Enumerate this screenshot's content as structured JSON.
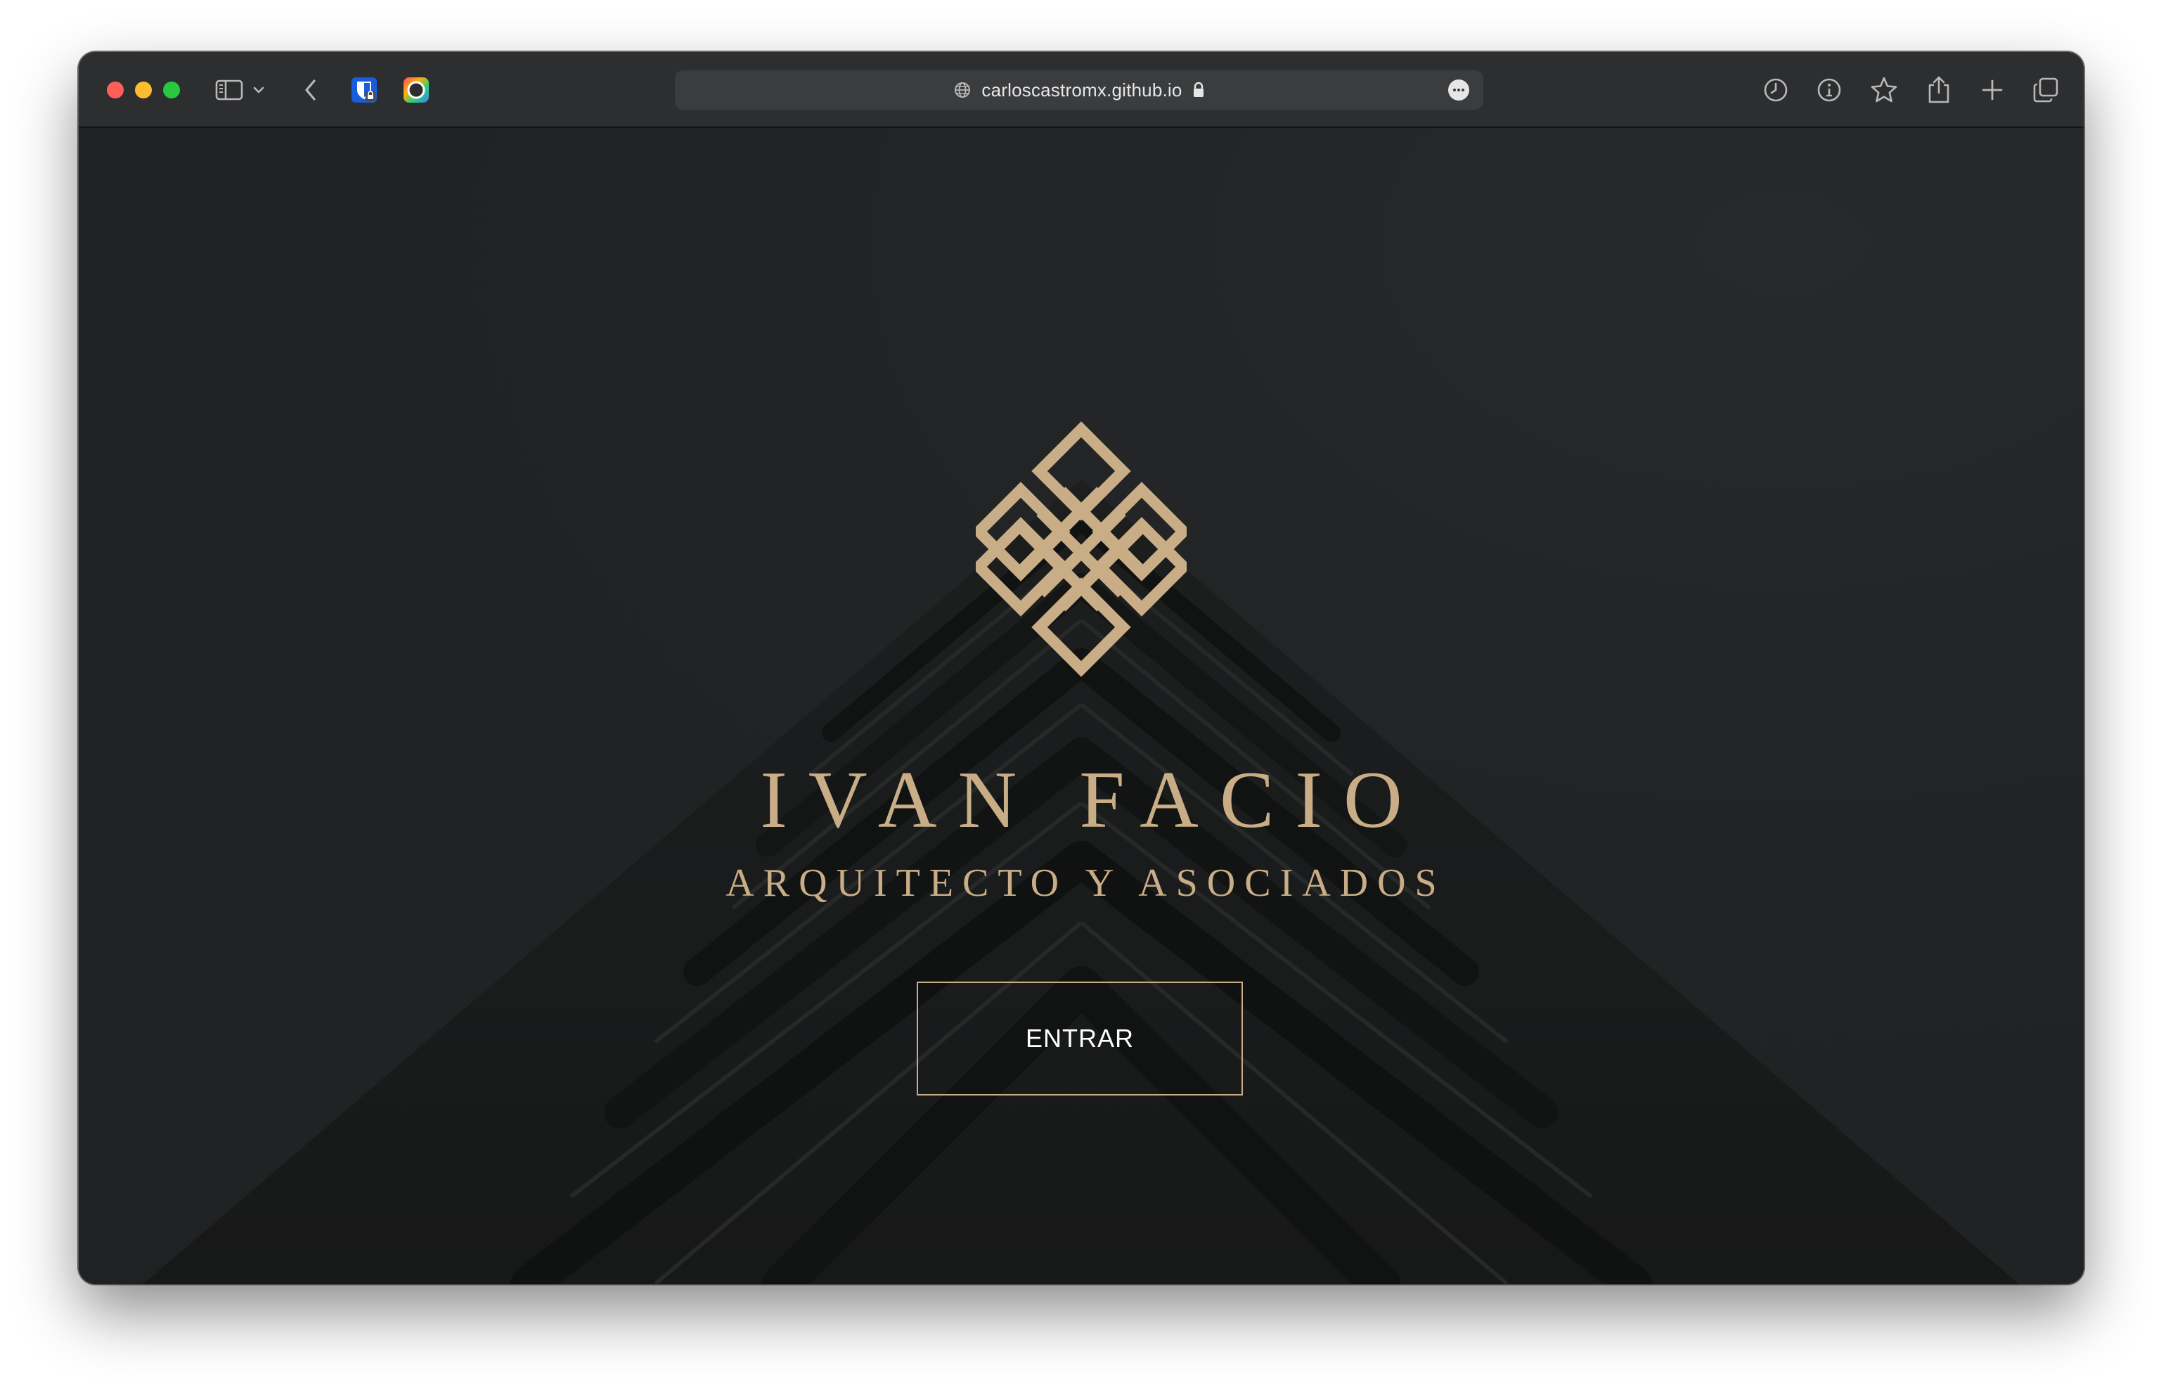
{
  "browser": {
    "url": "carloscastromx.github.io",
    "icons": {
      "sidebar": "sidebar-icon",
      "chevron": "chevron-down-icon",
      "back": "back-arrow-icon",
      "extension_1": "bitwarden-shield-icon",
      "extension_2": "color-ring-icon",
      "site": "globe-icon",
      "secure": "lock-icon",
      "more": "ellipsis-icon",
      "history": "clock-icon",
      "info": "info-icon",
      "bookmark": "star-icon",
      "share": "share-icon",
      "new_tab": "plus-icon",
      "tabs_overview": "tabs-icon"
    }
  },
  "page": {
    "logo": "endless-knot-logo",
    "title": "IVAN FACIO",
    "subtitle": "ARQUITECTO Y ASOCIADOS",
    "button_label": "ENTRAR"
  },
  "colors": {
    "accent_gold": "#c9ad86",
    "background": "#202224",
    "toolbar": "#2d2e30"
  }
}
